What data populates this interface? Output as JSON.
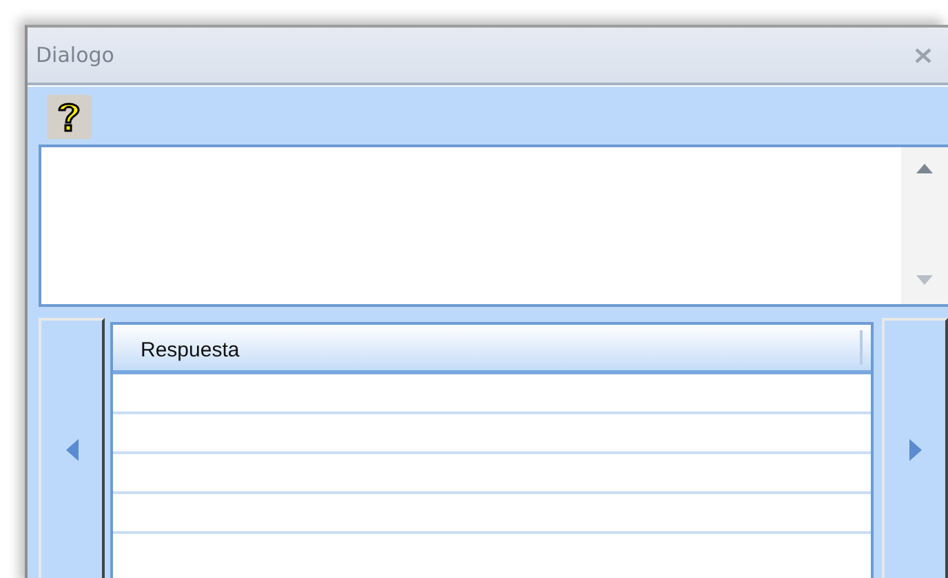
{
  "window": {
    "title": "Dialogo"
  },
  "grid": {
    "columns": [
      "Respuesta"
    ]
  }
}
